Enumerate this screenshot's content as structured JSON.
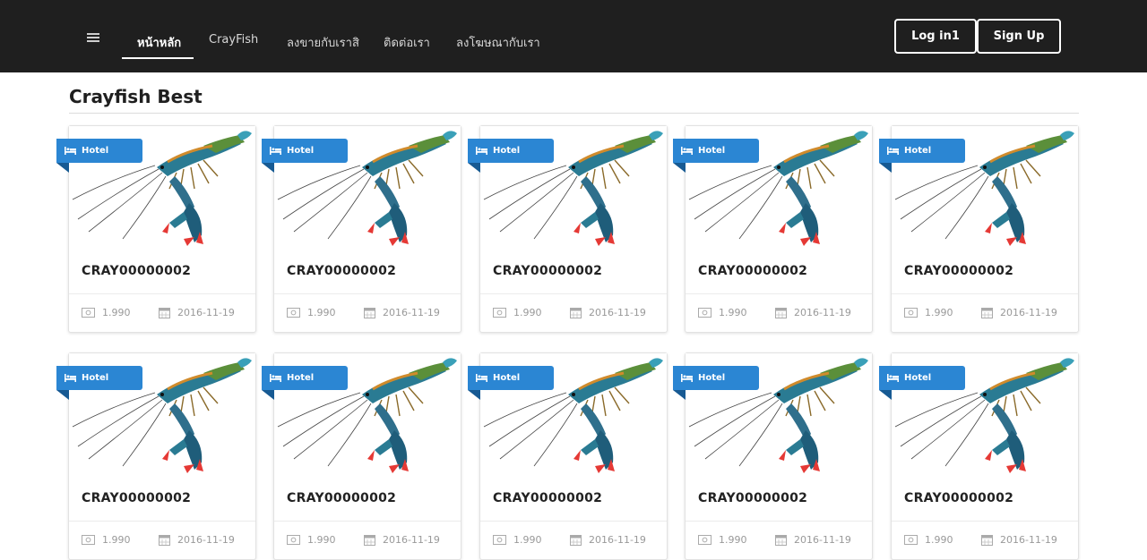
{
  "nav": {
    "menu_icon": "hamburger-menu-icon",
    "links": [
      "หน้าหลัก",
      "CrayFish",
      "ลงขายกับเราสิ",
      "ติดต่อเรา",
      "ลงโฆษณากับเรา"
    ],
    "active_index": 0,
    "login_label": "Log in1",
    "signup_label": "Sign Up"
  },
  "section": {
    "title": "Crayfish Best"
  },
  "colors": {
    "navbar": "#1f1f1f",
    "ribbon": "#2b86d3",
    "ribbon_fold": "#175a93",
    "crayfish_claw_tip": "#e53935",
    "crayfish_shell": "#2a7b93"
  },
  "cards": [
    {
      "badge": "Hotel",
      "badge_icon": "bed-icon",
      "title": "CRAY00000002",
      "price": "1.990",
      "price_icon": "money-icon",
      "date": "2016-11-19",
      "date_icon": "calendar-icon",
      "image": "crayfish-photo"
    },
    {
      "badge": "Hotel",
      "badge_icon": "bed-icon",
      "title": "CRAY00000002",
      "price": "1.990",
      "price_icon": "money-icon",
      "date": "2016-11-19",
      "date_icon": "calendar-icon",
      "image": "crayfish-photo"
    },
    {
      "badge": "Hotel",
      "badge_icon": "bed-icon",
      "title": "CRAY00000002",
      "price": "1.990",
      "price_icon": "money-icon",
      "date": "2016-11-19",
      "date_icon": "calendar-icon",
      "image": "crayfish-photo"
    },
    {
      "badge": "Hotel",
      "badge_icon": "bed-icon",
      "title": "CRAY00000002",
      "price": "1.990",
      "price_icon": "money-icon",
      "date": "2016-11-19",
      "date_icon": "calendar-icon",
      "image": "crayfish-photo"
    },
    {
      "badge": "Hotel",
      "badge_icon": "bed-icon",
      "title": "CRAY00000002",
      "price": "1.990",
      "price_icon": "money-icon",
      "date": "2016-11-19",
      "date_icon": "calendar-icon",
      "image": "crayfish-photo"
    },
    {
      "badge": "Hotel",
      "badge_icon": "bed-icon",
      "title": "CRAY00000002",
      "price": "1.990",
      "price_icon": "money-icon",
      "date": "2016-11-19",
      "date_icon": "calendar-icon",
      "image": "crayfish-photo"
    },
    {
      "badge": "Hotel",
      "badge_icon": "bed-icon",
      "title": "CRAY00000002",
      "price": "1.990",
      "price_icon": "money-icon",
      "date": "2016-11-19",
      "date_icon": "calendar-icon",
      "image": "crayfish-photo"
    },
    {
      "badge": "Hotel",
      "badge_icon": "bed-icon",
      "title": "CRAY00000002",
      "price": "1.990",
      "price_icon": "money-icon",
      "date": "2016-11-19",
      "date_icon": "calendar-icon",
      "image": "crayfish-photo"
    },
    {
      "badge": "Hotel",
      "badge_icon": "bed-icon",
      "title": "CRAY00000002",
      "price": "1.990",
      "price_icon": "money-icon",
      "date": "2016-11-19",
      "date_icon": "calendar-icon",
      "image": "crayfish-photo"
    },
    {
      "badge": "Hotel",
      "badge_icon": "bed-icon",
      "title": "CRAY00000002",
      "price": "1.990",
      "price_icon": "money-icon",
      "date": "2016-11-19",
      "date_icon": "calendar-icon",
      "image": "crayfish-photo"
    }
  ]
}
